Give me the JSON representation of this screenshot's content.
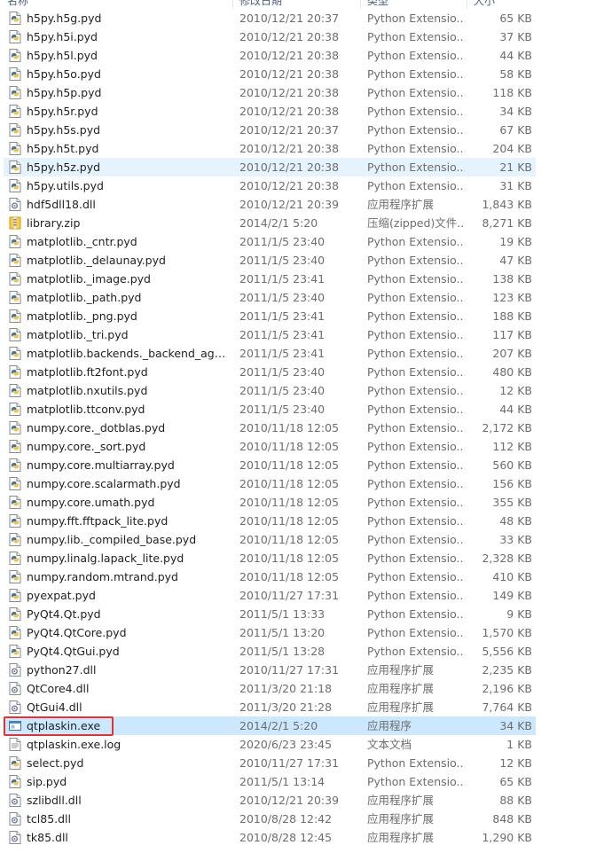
{
  "header": {
    "name": "名称",
    "date": "修改日期",
    "type": "类型",
    "size": "大小"
  },
  "colors": {
    "selected": "#cce8ff",
    "hover": "#e5f3ff",
    "highlight": "#e8312f"
  },
  "files": [
    {
      "name": "h5py.h5g.pyd",
      "date": "2010/12/21 20:37",
      "type": "Python Extensio...",
      "size": "65 KB",
      "icon": "pyd-icon"
    },
    {
      "name": "h5py.h5i.pyd",
      "date": "2010/12/21 20:38",
      "type": "Python Extensio...",
      "size": "37 KB",
      "icon": "pyd-icon"
    },
    {
      "name": "h5py.h5l.pyd",
      "date": "2010/12/21 20:38",
      "type": "Python Extensio...",
      "size": "44 KB",
      "icon": "pyd-icon"
    },
    {
      "name": "h5py.h5o.pyd",
      "date": "2010/12/21 20:38",
      "type": "Python Extensio...",
      "size": "58 KB",
      "icon": "pyd-icon"
    },
    {
      "name": "h5py.h5p.pyd",
      "date": "2010/12/21 20:38",
      "type": "Python Extensio...",
      "size": "118 KB",
      "icon": "pyd-icon"
    },
    {
      "name": "h5py.h5r.pyd",
      "date": "2010/12/21 20:38",
      "type": "Python Extensio...",
      "size": "34 KB",
      "icon": "pyd-icon"
    },
    {
      "name": "h5py.h5s.pyd",
      "date": "2010/12/21 20:37",
      "type": "Python Extensio...",
      "size": "67 KB",
      "icon": "pyd-icon"
    },
    {
      "name": "h5py.h5t.pyd",
      "date": "2010/12/21 20:38",
      "type": "Python Extensio...",
      "size": "204 KB",
      "icon": "pyd-icon"
    },
    {
      "name": "h5py.h5z.pyd",
      "date": "2010/12/21 20:38",
      "type": "Python Extensio...",
      "size": "21 KB",
      "icon": "pyd-icon",
      "state": "hover"
    },
    {
      "name": "h5py.utils.pyd",
      "date": "2010/12/21 20:38",
      "type": "Python Extensio...",
      "size": "31 KB",
      "icon": "pyd-icon"
    },
    {
      "name": "hdf5dll18.dll",
      "date": "2010/12/21 20:39",
      "type": "应用程序扩展",
      "size": "1,843 KB",
      "icon": "dll-icon"
    },
    {
      "name": "library.zip",
      "date": "2014/2/1 5:20",
      "type": "压缩(zipped)文件...",
      "size": "8,271 KB",
      "icon": "zip-icon"
    },
    {
      "name": "matplotlib._cntr.pyd",
      "date": "2011/1/5 23:40",
      "type": "Python Extensio...",
      "size": "19 KB",
      "icon": "pyd-icon"
    },
    {
      "name": "matplotlib._delaunay.pyd",
      "date": "2011/1/5 23:40",
      "type": "Python Extensio...",
      "size": "47 KB",
      "icon": "pyd-icon"
    },
    {
      "name": "matplotlib._image.pyd",
      "date": "2011/1/5 23:41",
      "type": "Python Extensio...",
      "size": "138 KB",
      "icon": "pyd-icon"
    },
    {
      "name": "matplotlib._path.pyd",
      "date": "2011/1/5 23:40",
      "type": "Python Extensio...",
      "size": "123 KB",
      "icon": "pyd-icon"
    },
    {
      "name": "matplotlib._png.pyd",
      "date": "2011/1/5 23:41",
      "type": "Python Extensio...",
      "size": "188 KB",
      "icon": "pyd-icon"
    },
    {
      "name": "matplotlib._tri.pyd",
      "date": "2011/1/5 23:41",
      "type": "Python Extensio...",
      "size": "117 KB",
      "icon": "pyd-icon"
    },
    {
      "name": "matplotlib.backends._backend_agg.p...",
      "date": "2011/1/5 23:41",
      "type": "Python Extensio...",
      "size": "207 KB",
      "icon": "pyd-icon"
    },
    {
      "name": "matplotlib.ft2font.pyd",
      "date": "2011/1/5 23:40",
      "type": "Python Extensio...",
      "size": "480 KB",
      "icon": "pyd-icon"
    },
    {
      "name": "matplotlib.nxutils.pyd",
      "date": "2011/1/5 23:40",
      "type": "Python Extensio...",
      "size": "12 KB",
      "icon": "pyd-icon"
    },
    {
      "name": "matplotlib.ttconv.pyd",
      "date": "2011/1/5 23:40",
      "type": "Python Extensio...",
      "size": "44 KB",
      "icon": "pyd-icon"
    },
    {
      "name": "numpy.core._dotblas.pyd",
      "date": "2010/11/18 12:05",
      "type": "Python Extensio...",
      "size": "2,172 KB",
      "icon": "pyd-icon"
    },
    {
      "name": "numpy.core._sort.pyd",
      "date": "2010/11/18 12:05",
      "type": "Python Extensio...",
      "size": "112 KB",
      "icon": "pyd-icon"
    },
    {
      "name": "numpy.core.multiarray.pyd",
      "date": "2010/11/18 12:05",
      "type": "Python Extensio...",
      "size": "560 KB",
      "icon": "pyd-icon"
    },
    {
      "name": "numpy.core.scalarmath.pyd",
      "date": "2010/11/18 12:05",
      "type": "Python Extensio...",
      "size": "156 KB",
      "icon": "pyd-icon"
    },
    {
      "name": "numpy.core.umath.pyd",
      "date": "2010/11/18 12:05",
      "type": "Python Extensio...",
      "size": "355 KB",
      "icon": "pyd-icon"
    },
    {
      "name": "numpy.fft.fftpack_lite.pyd",
      "date": "2010/11/18 12:05",
      "type": "Python Extensio...",
      "size": "48 KB",
      "icon": "pyd-icon"
    },
    {
      "name": "numpy.lib._compiled_base.pyd",
      "date": "2010/11/18 12:05",
      "type": "Python Extensio...",
      "size": "33 KB",
      "icon": "pyd-icon"
    },
    {
      "name": "numpy.linalg.lapack_lite.pyd",
      "date": "2010/11/18 12:05",
      "type": "Python Extensio...",
      "size": "2,328 KB",
      "icon": "pyd-icon"
    },
    {
      "name": "numpy.random.mtrand.pyd",
      "date": "2010/11/18 12:05",
      "type": "Python Extensio...",
      "size": "410 KB",
      "icon": "pyd-icon"
    },
    {
      "name": "pyexpat.pyd",
      "date": "2010/11/27 17:31",
      "type": "Python Extensio...",
      "size": "149 KB",
      "icon": "pyd-icon"
    },
    {
      "name": "PyQt4.Qt.pyd",
      "date": "2011/5/1 13:33",
      "type": "Python Extensio...",
      "size": "9 KB",
      "icon": "pyd-icon"
    },
    {
      "name": "PyQt4.QtCore.pyd",
      "date": "2011/5/1 13:20",
      "type": "Python Extensio...",
      "size": "1,570 KB",
      "icon": "pyd-icon"
    },
    {
      "name": "PyQt4.QtGui.pyd",
      "date": "2011/5/1 13:28",
      "type": "Python Extensio...",
      "size": "5,556 KB",
      "icon": "pyd-icon"
    },
    {
      "name": "python27.dll",
      "date": "2010/11/27 17:31",
      "type": "应用程序扩展",
      "size": "2,235 KB",
      "icon": "dll-icon"
    },
    {
      "name": "QtCore4.dll",
      "date": "2011/3/20 21:18",
      "type": "应用程序扩展",
      "size": "2,196 KB",
      "icon": "dll-icon"
    },
    {
      "name": "QtGui4.dll",
      "date": "2011/3/20 21:28",
      "type": "应用程序扩展",
      "size": "7,764 KB",
      "icon": "dll-icon"
    },
    {
      "name": "qtplaskin.exe",
      "date": "2014/2/1 5:20",
      "type": "应用程序",
      "size": "34 KB",
      "icon": "exe-icon",
      "state": "selected"
    },
    {
      "name": "qtplaskin.exe.log",
      "date": "2020/6/23 23:45",
      "type": "文本文档",
      "size": "1 KB",
      "icon": "log-icon"
    },
    {
      "name": "select.pyd",
      "date": "2010/11/27 17:31",
      "type": "Python Extensio...",
      "size": "12 KB",
      "icon": "pyd-icon"
    },
    {
      "name": "sip.pyd",
      "date": "2011/5/1 13:14",
      "type": "Python Extensio...",
      "size": "65 KB",
      "icon": "pyd-icon"
    },
    {
      "name": "szlibdll.dll",
      "date": "2010/12/21 20:39",
      "type": "应用程序扩展",
      "size": "88 KB",
      "icon": "dll-icon"
    },
    {
      "name": "tcl85.dll",
      "date": "2010/8/28 12:42",
      "type": "应用程序扩展",
      "size": "848 KB",
      "icon": "dll-icon"
    },
    {
      "name": "tk85.dll",
      "date": "2010/8/28 12:45",
      "type": "应用程序扩展",
      "size": "1,290 KB",
      "icon": "dll-icon"
    }
  ]
}
